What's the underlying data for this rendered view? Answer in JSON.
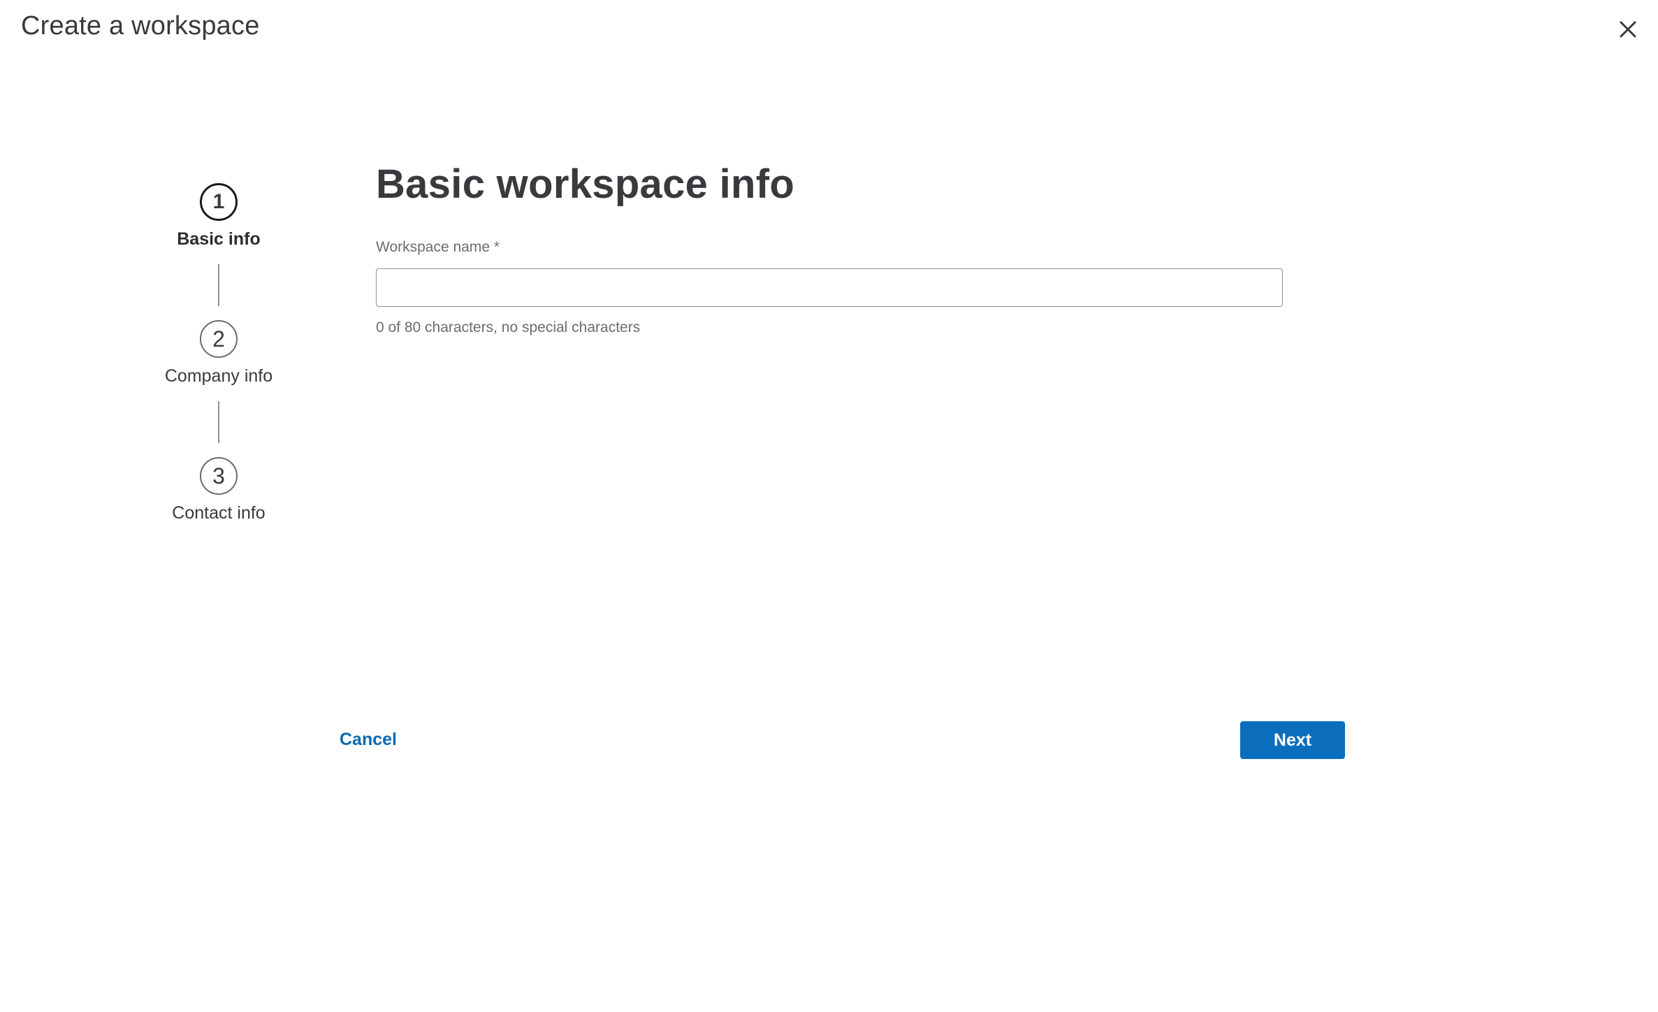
{
  "dialog": {
    "title": "Create a workspace",
    "close_icon": "close-icon"
  },
  "stepper": {
    "steps": [
      {
        "number": "1",
        "label": "Basic info",
        "state": "active"
      },
      {
        "number": "2",
        "label": "Company info",
        "state": "inactive"
      },
      {
        "number": "3",
        "label": "Contact info",
        "state": "inactive"
      }
    ]
  },
  "form": {
    "heading": "Basic workspace info",
    "workspace_name": {
      "label": "Workspace name *",
      "value": "",
      "placeholder": "",
      "helper": "0 of 80 characters, no special characters"
    }
  },
  "actions": {
    "cancel_label": "Cancel",
    "next_label": "Next"
  },
  "colors": {
    "primary": "#0a6ebd",
    "link": "#0a6ab1",
    "text": "#393a3d",
    "muted": "#6b6c72"
  }
}
